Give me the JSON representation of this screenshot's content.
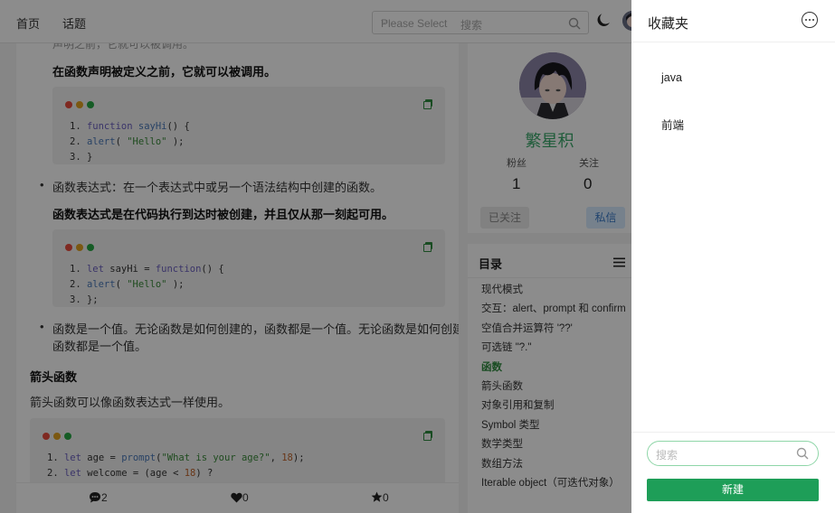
{
  "nav": {
    "home": "首页",
    "topic": "话题",
    "select_placeholder": "Please Select",
    "search_placeholder": "搜索"
  },
  "article": {
    "partial_top": "声明之前，它就可以被调用。",
    "decl_note": "在函数声明被定义之前，它就可以被调用。",
    "code1": [
      {
        "n": "1.",
        "parts": [
          [
            "kw",
            "function "
          ],
          [
            "fn",
            "sayHi"
          ],
          [
            "t",
            "() {"
          ]
        ]
      },
      {
        "n": "2.",
        "parts": [
          [
            "t",
            "  "
          ],
          [
            "fn",
            "alert"
          ],
          [
            "t",
            "( "
          ],
          [
            "str",
            "\"Hello\""
          ],
          [
            "t",
            " );"
          ]
        ]
      },
      {
        "n": "3.",
        "parts": [
          [
            "t",
            "}"
          ]
        ]
      }
    ],
    "bullet_expr": "函数表达式：在一个表达式中或另一个语法结构中创建的函数。",
    "expr_note": "函数表达式是在代码执行到达时被创建，并且仅从那一刻起可用。",
    "code2": [
      {
        "n": "1.",
        "parts": [
          [
            "kw",
            "let "
          ],
          [
            "t",
            "sayHi = "
          ],
          [
            "kw",
            "function"
          ],
          [
            "t",
            "() {"
          ]
        ]
      },
      {
        "n": "2.",
        "parts": [
          [
            "t",
            "  "
          ],
          [
            "fn",
            "alert"
          ],
          [
            "t",
            "( "
          ],
          [
            "str",
            "\"Hello\""
          ],
          [
            "t",
            " );"
          ]
        ]
      },
      {
        "n": "3.",
        "parts": [
          [
            "t",
            "};"
          ]
        ]
      }
    ],
    "bullet_value_1": "函数是一个值。无论函数是如何创建的，函数都是一个值。无论函数是如何创建的，",
    "bullet_value_2": "函数都是一个值。",
    "arrow_heading": "箭头函数",
    "arrow_text": "箭头函数可以像函数表达式一样使用。",
    "code3": [
      {
        "n": "1.",
        "parts": [
          [
            "kw",
            "let "
          ],
          [
            "t",
            "age = "
          ],
          [
            "fn",
            "prompt"
          ],
          [
            "t",
            "("
          ],
          [
            "str",
            "\"What is your age?\""
          ],
          [
            "t",
            ", "
          ],
          [
            "num",
            "18"
          ],
          [
            "t",
            ");"
          ]
        ]
      },
      {
        "n": "2.",
        "parts": [
          [
            "kw",
            "let "
          ],
          [
            "t",
            "welcome = (age < "
          ],
          [
            "num",
            "18"
          ],
          [
            "t",
            ") ?"
          ]
        ]
      }
    ]
  },
  "actions": {
    "comments": "2",
    "likes": "0",
    "stars": "0"
  },
  "profile": {
    "name": "繁星积",
    "fans_label": "粉丝",
    "fans": "1",
    "follow_label": "关注",
    "follow": "0",
    "followed_btn": "已关注",
    "message_btn": "私信"
  },
  "toc": {
    "title": "目录",
    "items": [
      "现代模式",
      "交互：alert、prompt 和 confirm",
      "空值合并运算符 '??'",
      "可选链 \"?.\"",
      "函数",
      "箭头函数",
      "对象引用和复制",
      "Symbol 类型",
      "数学类型",
      "数组方法",
      "Iterable object（可迭代对象）"
    ],
    "active_index": 4
  },
  "favorites": {
    "title": "收藏夹",
    "folders": [
      "java",
      "前端"
    ],
    "search_placeholder": "搜索",
    "new_button": "新建"
  },
  "colors": {
    "accent_green": "#1e9e58",
    "name_green": "#3aa86a",
    "overlay": "rgba(0,0,0,0.45)"
  }
}
